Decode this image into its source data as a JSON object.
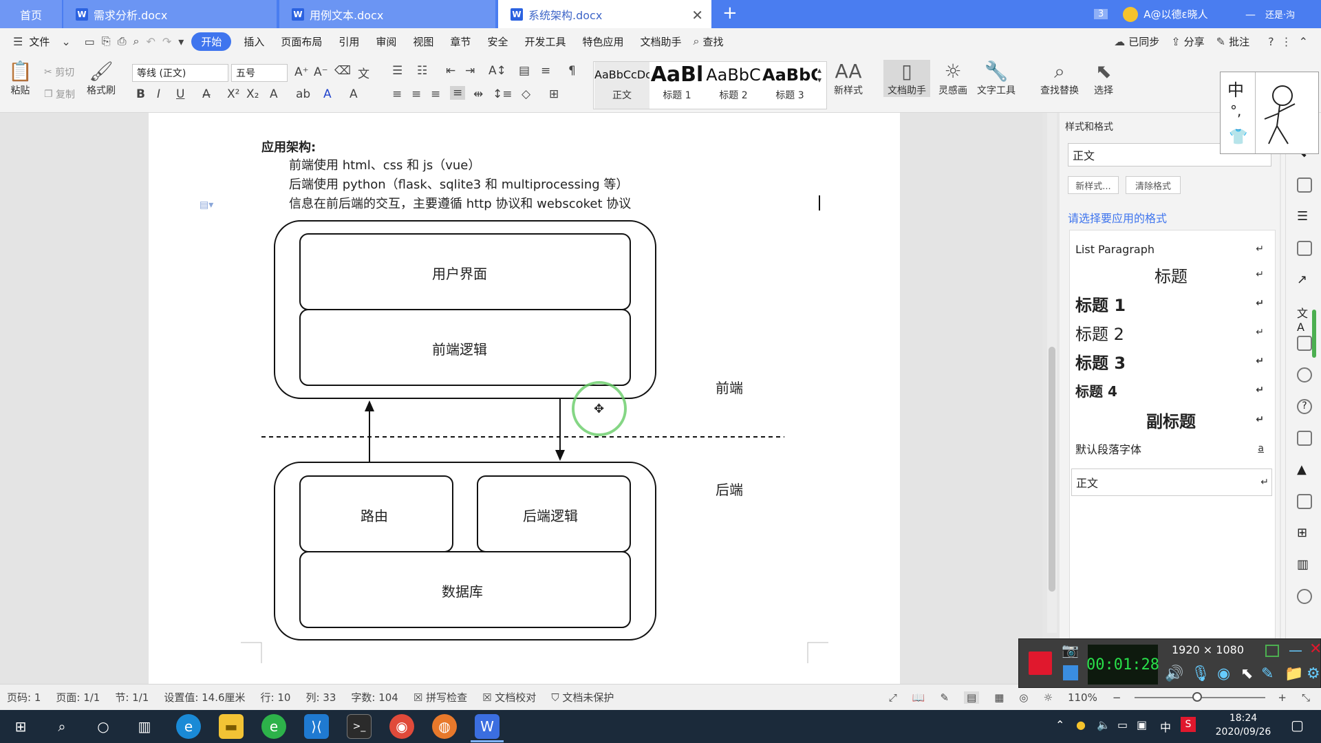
{
  "tabs": {
    "home": "首页",
    "t1": "需求分析.docx",
    "t2": "用例文本.docx",
    "t3": "系统架构.docx",
    "badge": "3",
    "user": "A@以德ε晓人",
    "restore": "还是·沟"
  },
  "menu": {
    "file": "文件",
    "items": [
      "开始",
      "插入",
      "页面布局",
      "引用",
      "审阅",
      "视图",
      "章节",
      "安全",
      "开发工具",
      "特色应用",
      "文档助手",
      "查找"
    ],
    "sync": "已同步",
    "share": "分享",
    "comment": "批注"
  },
  "ribbon": {
    "paste": "粘贴",
    "cut": "剪切",
    "copy": "复制",
    "format_painter": "格式刷",
    "font_name": "等线 (正文)",
    "font_size": "五号",
    "styles": [
      {
        "preview": "AaBbCcDc",
        "label": "正文"
      },
      {
        "preview": "AaBl",
        "label": "标题 1"
      },
      {
        "preview": "AaBbC",
        "label": "标题 2"
      },
      {
        "preview": "AaBbC",
        "label": "标题 3"
      }
    ],
    "new_style": "新样式",
    "doc_assistant": "文档助手",
    "inspiration": "灵感画",
    "text_tools": "文字工具",
    "find_replace": "查找替换",
    "select": "选择"
  },
  "document": {
    "heading": "应用架构:",
    "lines": [
      "前端使用 html、css 和 js（vue）",
      "后端使用 python（flask、sqlite3 和 multiprocessing 等）",
      "信息在前后端的交互，主要遵循 http 协议和 webscoket 协议"
    ],
    "diagram": {
      "frontend_boxes": [
        "用户界面",
        "前端逻辑"
      ],
      "backend_boxes": [
        "路由",
        "后端逻辑",
        "数据库"
      ],
      "frontend_label": "前端",
      "backend_label": "后端"
    }
  },
  "panel": {
    "title": "样式和格式",
    "current": "正文",
    "new_style_btn": "新样式...",
    "clear_btn": "清除格式",
    "prompt": "请选择要应用的格式",
    "items": [
      "List Paragraph",
      "标题",
      "标题 1",
      "标题 2",
      "标题 3",
      "标题 4",
      "副标题",
      "默认段落字体",
      "正文"
    ],
    "accent": "#3f75ee"
  },
  "ime": {
    "mode": "中"
  },
  "recorder": {
    "time": "00:01:28",
    "resolution": "1920 × 1080"
  },
  "status": {
    "page_code": "页码: 1",
    "pages": "页面: 1/1",
    "section": "节: 1/1",
    "setting": "设置值: 14.6厘米",
    "row": "行: 10",
    "col": "列: 33",
    "words": "字数: 104",
    "spell": "拼写检查",
    "proof": "文档校对",
    "protect": "文档未保护",
    "zoom": "110%"
  },
  "taskbar": {
    "time": "18:24",
    "date": "2020/09/26",
    "ime": "中"
  }
}
